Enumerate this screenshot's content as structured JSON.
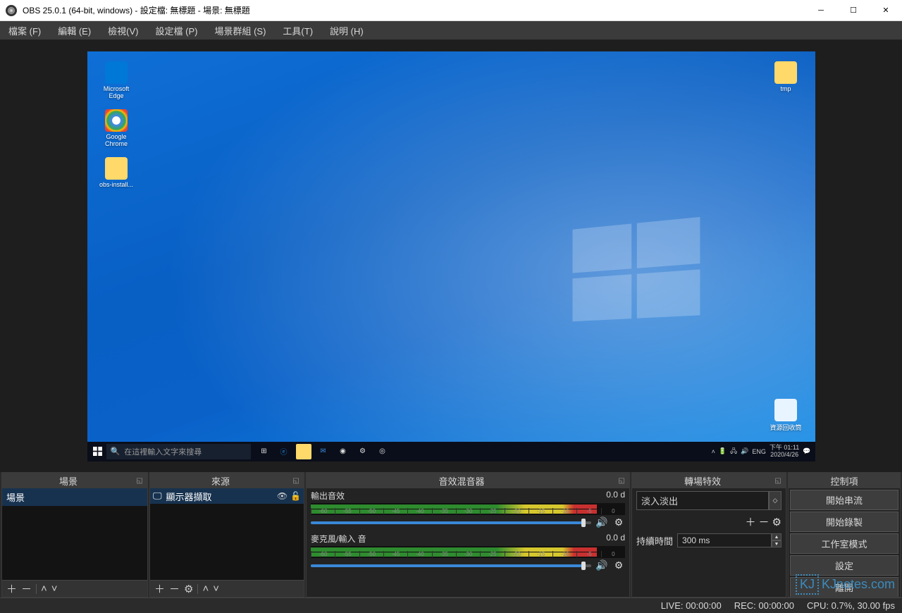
{
  "titlebar": {
    "title": "OBS 25.0.1 (64-bit, windows) - 設定檔: 無標題 - 場景: 無標題"
  },
  "menubar": {
    "file": "檔案 (F)",
    "edit": "編輯 (E)",
    "view": "檢視(V)",
    "profile": "設定檔 (P)",
    "scene_collection": "場景群組 (S)",
    "tools": "工具(T)",
    "help": "說明 (H)"
  },
  "preview": {
    "desk_icons": {
      "edge": "Microsoft Edge",
      "chrome": "Google Chrome",
      "obs_install": "obs-install...",
      "tmp": "tmp",
      "recycle": "資源回收筒"
    },
    "taskbar": {
      "search_placeholder": "在這裡輸入文字來搜尋",
      "lang": "ENG",
      "time": "下午 01:11",
      "date": "2020/4/26"
    }
  },
  "docks": {
    "scenes": {
      "title": "場景",
      "items": [
        "場景"
      ]
    },
    "sources": {
      "title": "來源",
      "items": [
        {
          "label": "顯示器擷取"
        }
      ]
    },
    "mixer": {
      "title": "音效混音器",
      "channels": [
        {
          "name": "輸出音效",
          "value": "0.0 d"
        },
        {
          "name": "麥克風/輸入 音",
          "value": "0.0 d"
        }
      ],
      "ticks": [
        "-60",
        "-55",
        "-50",
        "-45",
        "-40",
        "-35",
        "-30",
        "-25",
        "-20",
        "-15",
        "-10",
        "-5",
        "0"
      ]
    },
    "transitions": {
      "title": "轉場特效",
      "selected": "淡入淡出",
      "duration_label": "持續時間",
      "duration_value": "300 ms"
    },
    "controls": {
      "title": "控制項",
      "buttons": {
        "stream": "開始串流",
        "record": "開始錄製",
        "studio": "工作室模式",
        "settings": "設定",
        "exit": "離開"
      }
    }
  },
  "statusbar": {
    "live": "LIVE: 00:00:00",
    "rec": "REC: 00:00:00",
    "cpu": "CPU: 0.7%, 30.00 fps"
  },
  "watermark": "KJnotes.com"
}
